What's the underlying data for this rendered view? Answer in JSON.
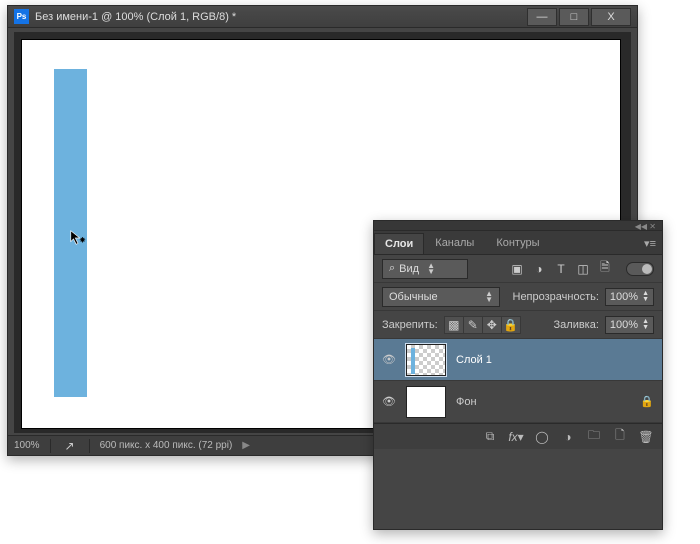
{
  "doc_window": {
    "app_icon": "Ps",
    "title": "Без имени-1 @ 100% (Слой 1, RGB/8) *",
    "buttons": {
      "min": "—",
      "max": "□",
      "close": "X"
    },
    "statusbar": {
      "zoom": "100%",
      "info": "600 пикс. x 400 пикс. (72 ppi)",
      "arrow": "▶"
    },
    "shape_color": "#6db2de"
  },
  "layers_panel": {
    "tabs": {
      "layers": "Слои",
      "channels": "Каналы",
      "paths": "Контуры"
    },
    "filter": {
      "kind_label": "Вид",
      "search_icon": "⌕"
    },
    "blend": {
      "mode": "Обычные",
      "opacity_label": "Непрозрачность:",
      "opacity_value": "100%"
    },
    "lock": {
      "label": "Закрепить:",
      "fill_label": "Заливка:",
      "fill_value": "100%"
    },
    "layers": [
      {
        "name": "Слой 1",
        "visible": true,
        "locked": false,
        "active": true
      },
      {
        "name": "Фон",
        "visible": true,
        "locked": true,
        "active": false
      }
    ]
  }
}
